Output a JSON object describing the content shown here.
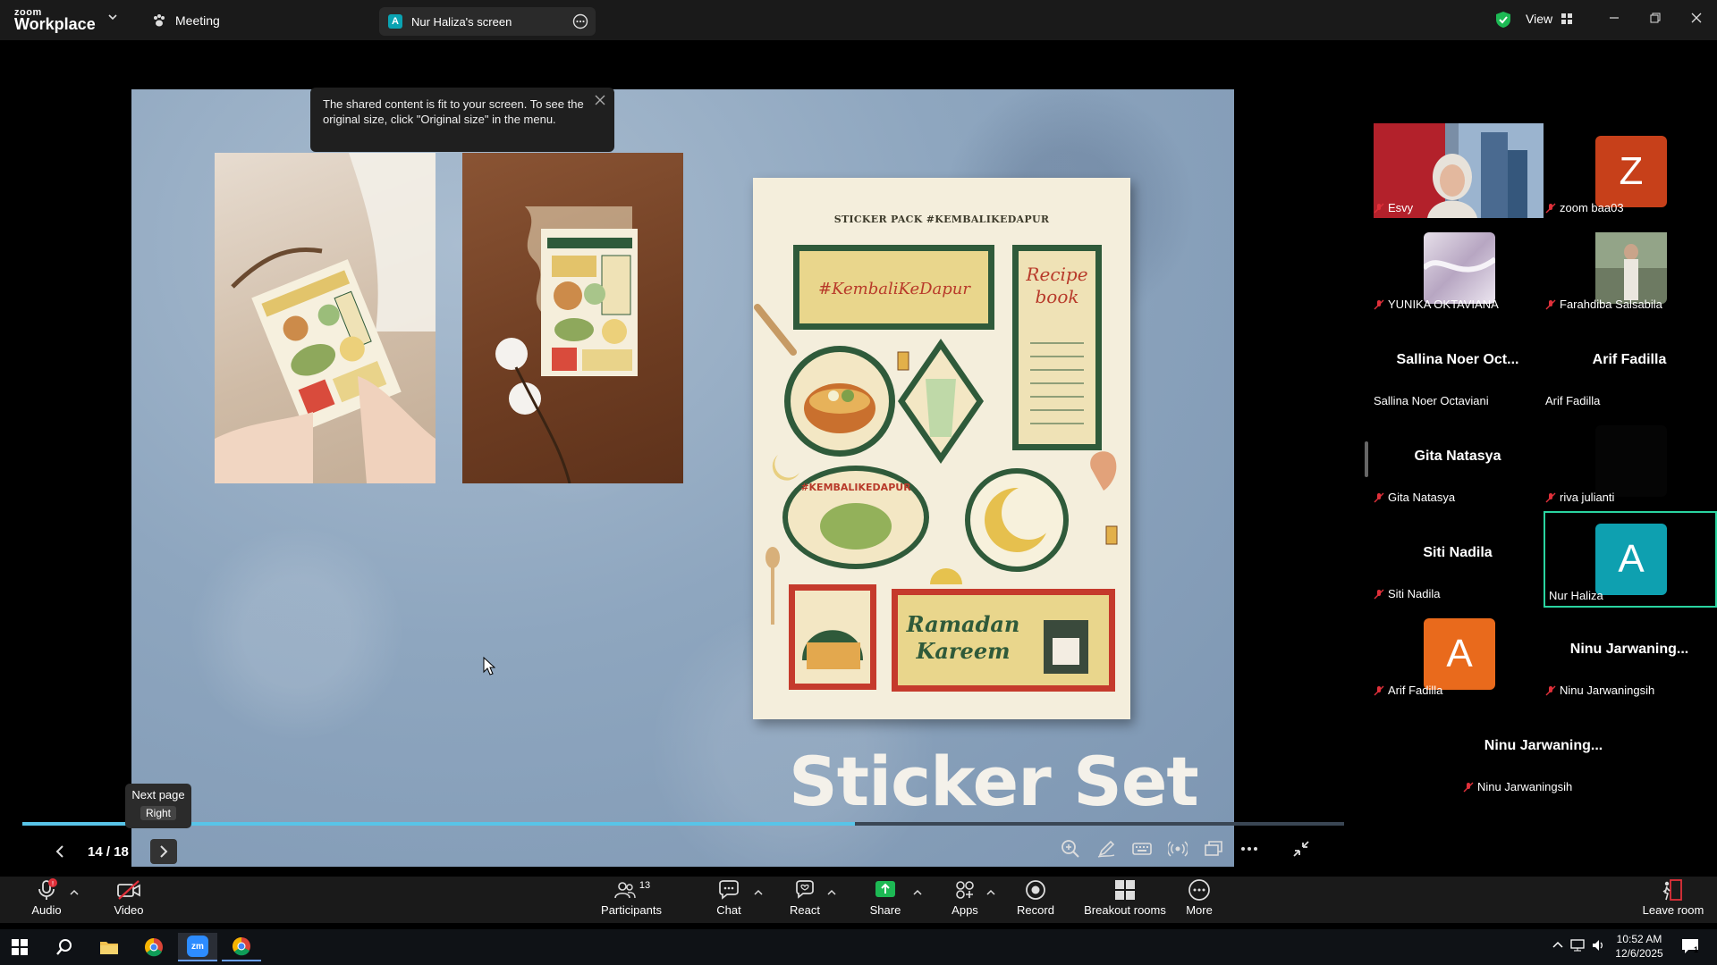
{
  "titlebar": {
    "logo_top": "zoom",
    "logo_bottom": "Workplace",
    "meeting_label": "Meeting",
    "screen_tab_avatar": "A",
    "screen_tab_label": "Nur Haliza's screen",
    "view_label": "View"
  },
  "share_notice": "The shared content is fit to your screen. To see the original size, click \"Original size\" in the menu.",
  "slide": {
    "sheet_title": "STICKER PACK #KEMBALIKEDAPUR",
    "heading": "Sticker Set"
  },
  "page_control": {
    "tooltip_title": "Next page",
    "tooltip_key": "Right",
    "page_indicator": "14 / 18",
    "progress_fraction": 0.63
  },
  "gallery": {
    "tiles": [
      {
        "name": "Esvy",
        "big": "",
        "avatar": "",
        "color": ""
      },
      {
        "name": "zoom baa03",
        "big": "",
        "avatar": "Z",
        "color": "#c7401a"
      },
      {
        "name": "YUNIKA OKTAVIANA",
        "big": "",
        "avatar": "",
        "color": ""
      },
      {
        "name": "Farahdiba Salsabila",
        "big": "",
        "avatar": "",
        "color": ""
      },
      {
        "name": "Sallina Noer Octaviani",
        "big": "Sallina Noer Oct...",
        "avatar": "",
        "color": ""
      },
      {
        "name": "Arif Fadilla",
        "big": "Arif Fadilla",
        "avatar": "",
        "color": ""
      },
      {
        "name": "Gita Natasya",
        "big": "Gita Natasya",
        "avatar": "",
        "color": ""
      },
      {
        "name": "riva julianti",
        "big": "",
        "avatar": "",
        "color": ""
      },
      {
        "name": "Siti Nadila",
        "big": "Siti Nadila",
        "avatar": "",
        "color": ""
      },
      {
        "name": "Nur Haliza",
        "big": "",
        "avatar": "A",
        "color": "#0ea0b0"
      },
      {
        "name": "Arif Fadilla",
        "big": "",
        "avatar": "A",
        "color": "#e96a1c"
      },
      {
        "name": "Ninu Jarwaningsih",
        "big": "Ninu Jarwaning...",
        "avatar": "",
        "color": ""
      },
      {
        "name": "Ninu Jarwaningsih",
        "big": "Ninu Jarwaning...",
        "avatar": "",
        "color": ""
      }
    ]
  },
  "toolbar": {
    "audio": "Audio",
    "video": "Video",
    "participants": "Participants",
    "participants_count": "13",
    "chat": "Chat",
    "react": "React",
    "share": "Share",
    "apps": "Apps",
    "record": "Record",
    "breakout": "Breakout rooms",
    "more": "More",
    "leave": "Leave room"
  },
  "taskbar": {
    "time": "10:52 AM",
    "date": "12/6/2025",
    "zoom_label": "zm",
    "notification_count": "1"
  },
  "colors": {
    "accent_blue": "#58c4e8",
    "share_green": "#1db954",
    "mic_red": "#e0303a",
    "active_speaker": "#2ad4a0"
  }
}
